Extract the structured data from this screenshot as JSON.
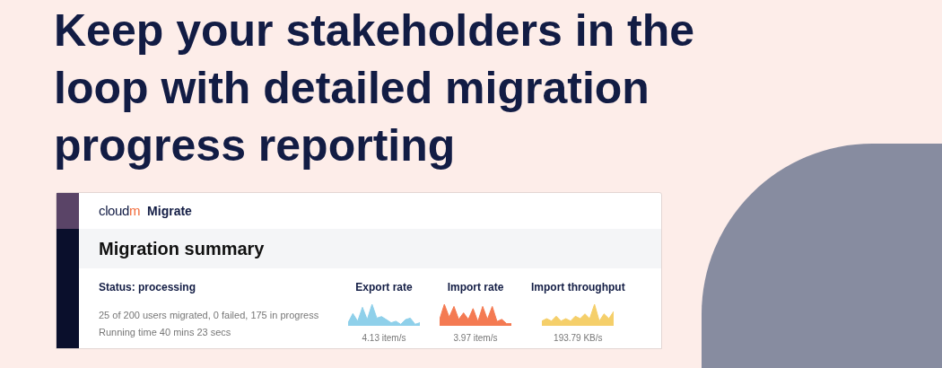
{
  "headline": [
    "Keep your stakeholders in the",
    "loop with detailed migration",
    "progress reporting"
  ],
  "app": {
    "logo_main": "cloud",
    "logo_accent": "m",
    "product": "Migrate",
    "title": "Migration summary",
    "status": "Status: processing",
    "details": [
      "25 of 200 users migrated, 0 failed, 175 in progress",
      "Running time 40 mins 23 secs"
    ],
    "metrics": [
      {
        "label": "Export rate",
        "reading": "4.13 item/s",
        "color": "#8fd0ea"
      },
      {
        "label": "Import rate",
        "reading": "3.97 item/s",
        "color": "#f47a52"
      },
      {
        "label": "Import throughput",
        "reading": "193.79 KB/s",
        "color": "#f5cf6a"
      }
    ]
  }
}
